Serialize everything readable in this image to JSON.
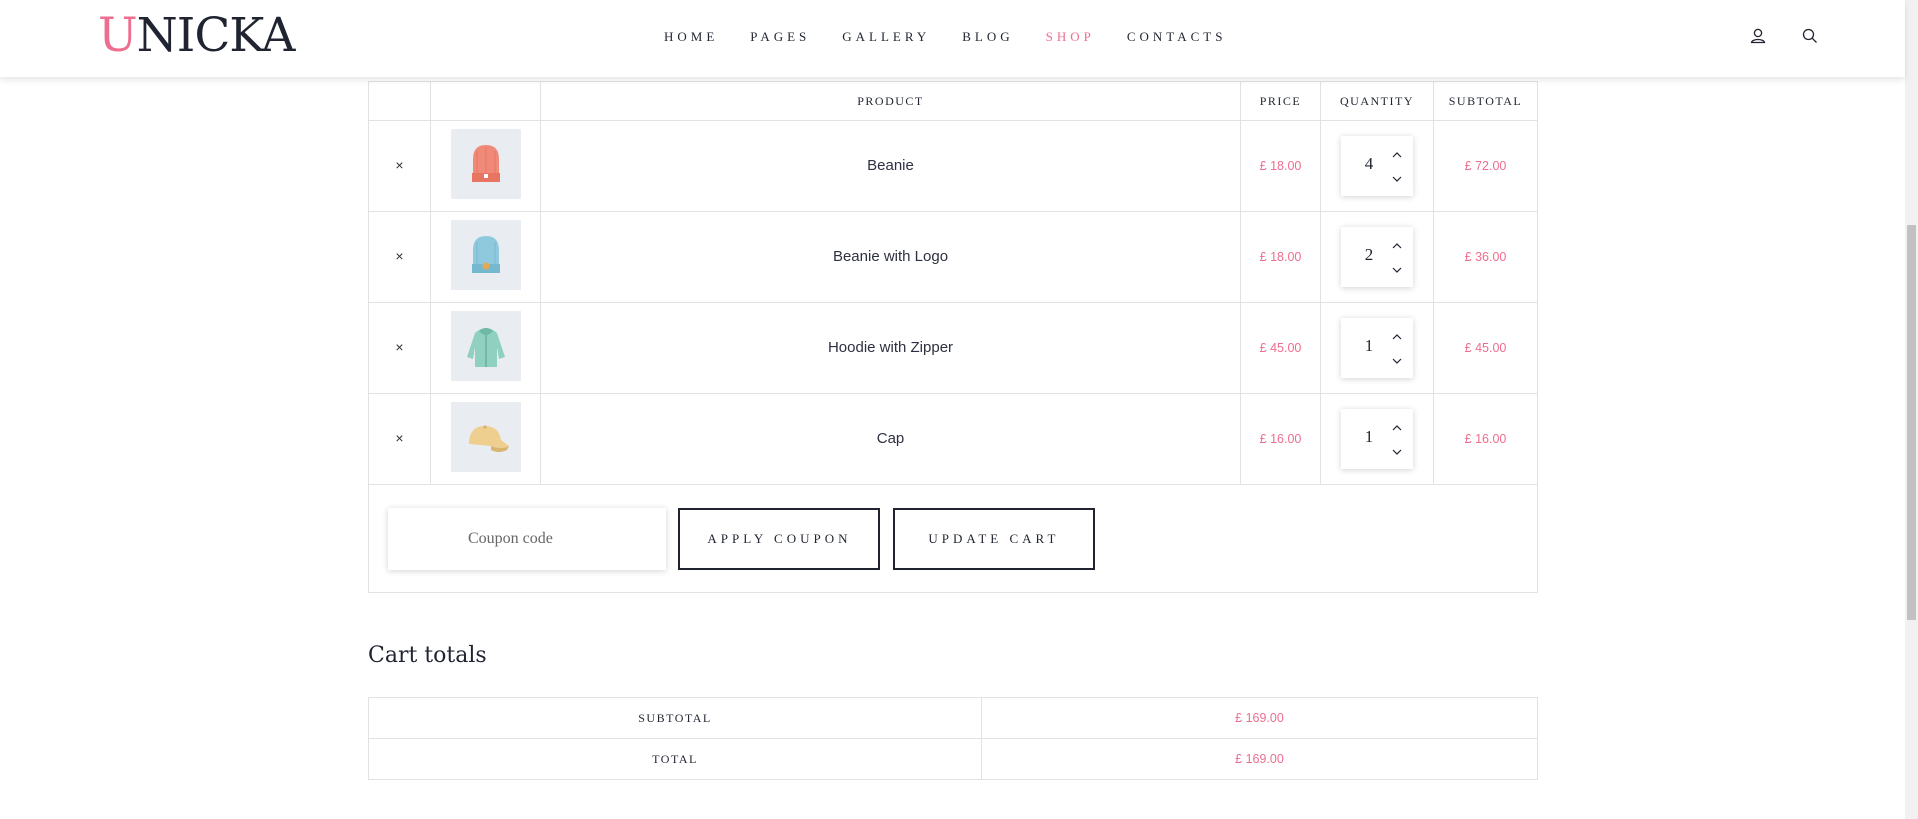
{
  "brand": {
    "first_letter": "U",
    "rest": "NICKA",
    "accent_color": "#ee6e8f"
  },
  "nav": {
    "items": [
      {
        "label": "HOME",
        "active": false
      },
      {
        "label": "PAGES",
        "active": false
      },
      {
        "label": "GALLERY",
        "active": false
      },
      {
        "label": "BLOG",
        "active": false
      },
      {
        "label": "SHOP",
        "active": true
      },
      {
        "label": "CONTACTS",
        "active": false
      }
    ],
    "icons": [
      "user-icon",
      "search-icon"
    ]
  },
  "cart": {
    "headers": {
      "product": "PRODUCT",
      "price": "PRICE",
      "quantity": "QUANTITY",
      "subtotal": "SUBTOTAL"
    },
    "remove_symbol": "×",
    "items": [
      {
        "name": "Beanie",
        "price": "£ 18.00",
        "quantity": "4",
        "subtotal": "£ 72.00",
        "image": "beanie-thumbnail",
        "color": "#f08a78"
      },
      {
        "name": "Beanie with Logo",
        "price": "£ 18.00",
        "quantity": "2",
        "subtotal": "£ 36.00",
        "image": "beanie-with-logo-thumbnail",
        "color": "#8ec9dd"
      },
      {
        "name": "Hoodie with Zipper",
        "price": "£ 45.00",
        "quantity": "1",
        "subtotal": "£ 45.00",
        "image": "hoodie-thumbnail",
        "color": "#8fd0c0"
      },
      {
        "name": "Cap",
        "price": "£ 16.00",
        "quantity": "1",
        "subtotal": "£ 16.00",
        "image": "cap-thumbnail",
        "color": "#eecf8f"
      }
    ],
    "coupon": {
      "placeholder": "Coupon code",
      "value": ""
    },
    "apply_coupon_label": "APPLY COUPON",
    "update_cart_label": "UPDATE CART"
  },
  "totals": {
    "title": "Cart totals",
    "rows": [
      {
        "label": "SUBTOTAL",
        "value": "£ 169.00"
      },
      {
        "label": "TOTAL",
        "value": "£ 169.00"
      }
    ]
  }
}
